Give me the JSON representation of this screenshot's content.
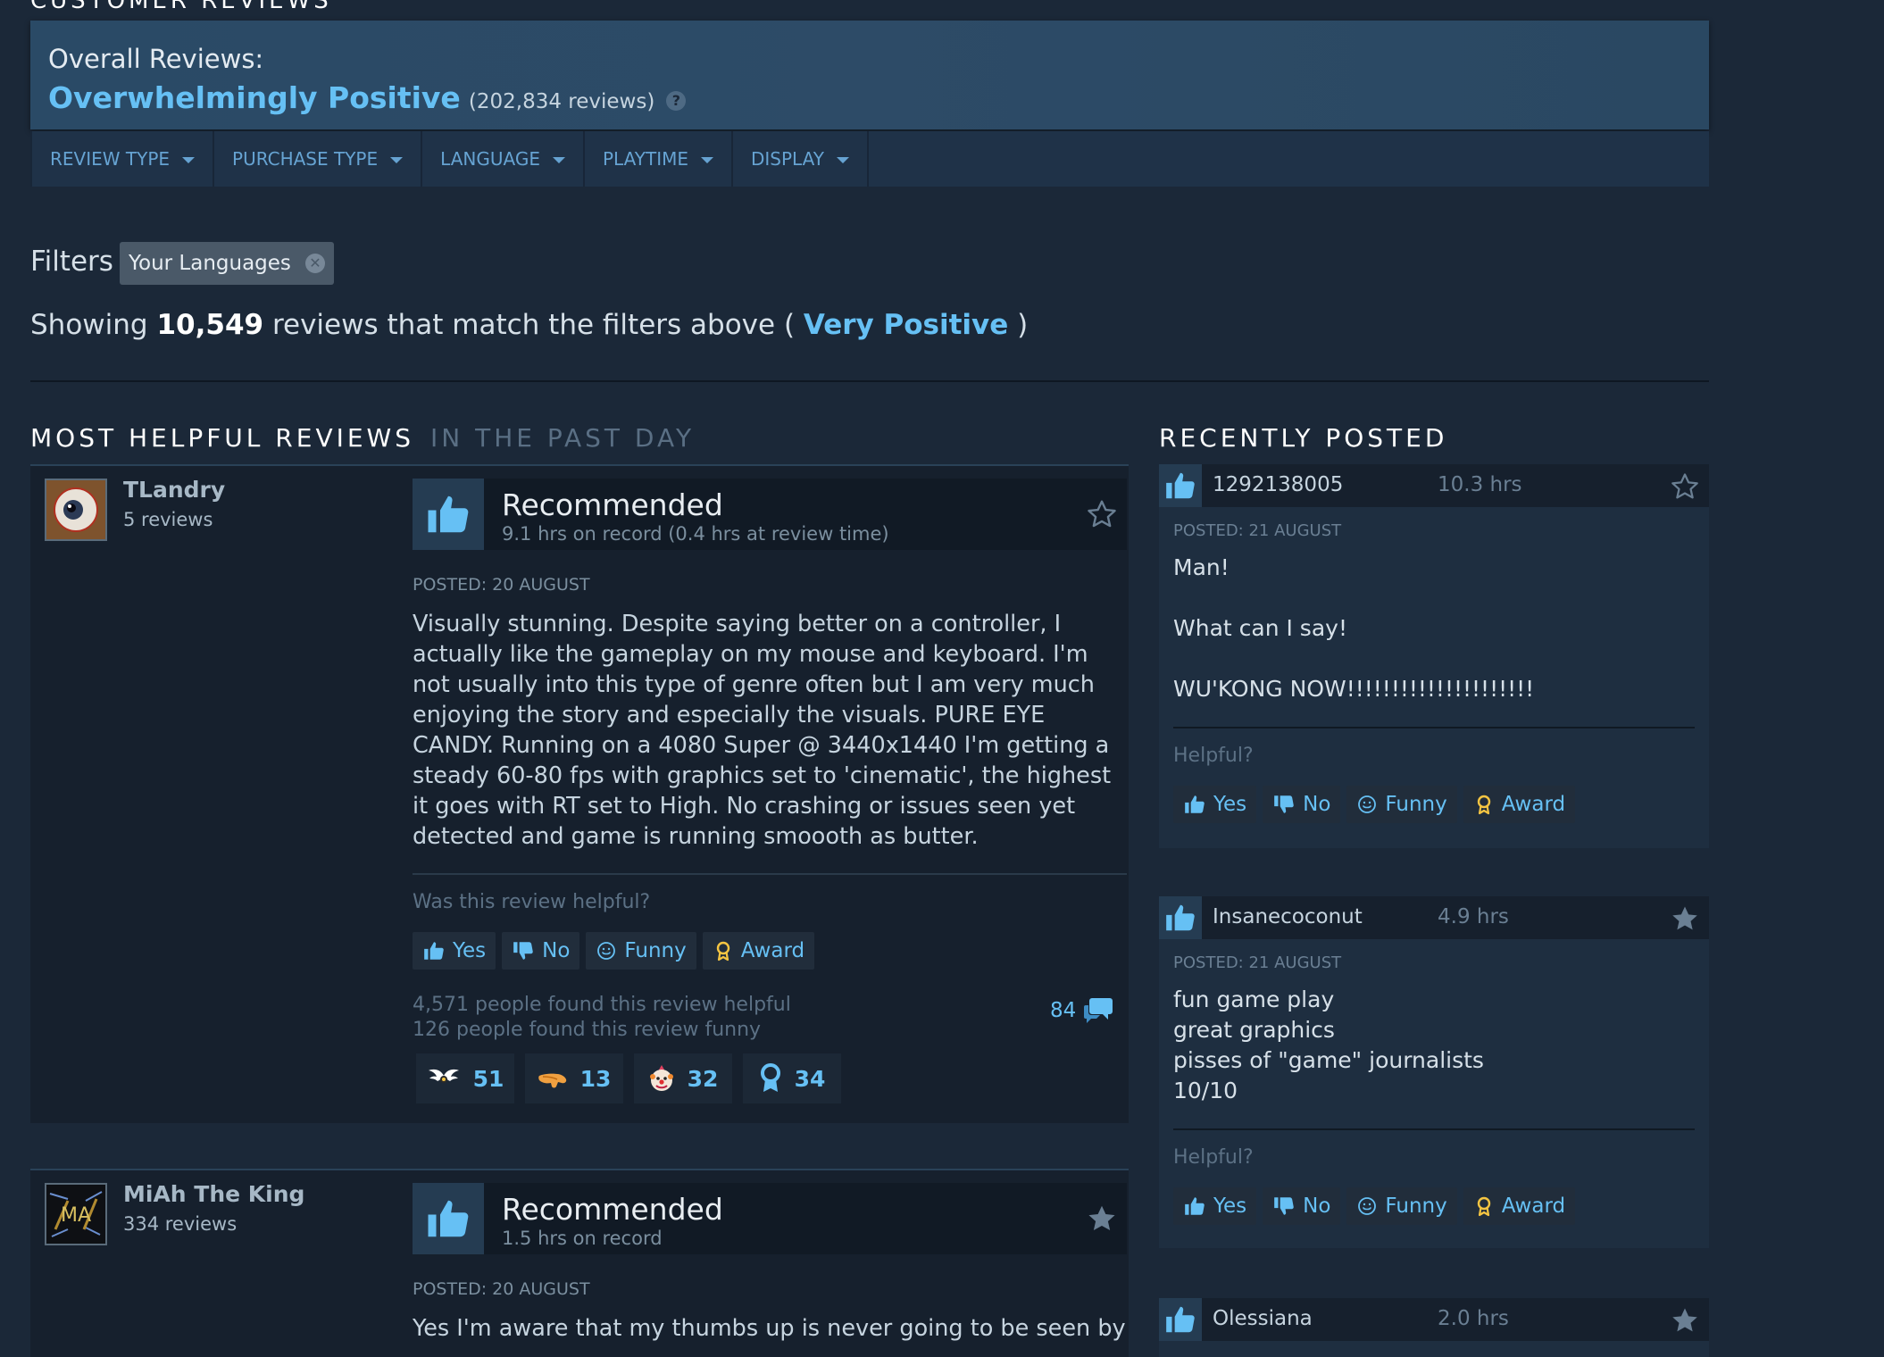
{
  "section": {
    "title": "Customer Reviews"
  },
  "overall": {
    "label": "Overall Reviews:",
    "score": "Overwhelmingly Positive",
    "count": "(202,834 reviews)",
    "help": "?"
  },
  "filter_tabs": [
    {
      "label": "Review Type"
    },
    {
      "label": "Purchase Type"
    },
    {
      "label": "Language"
    },
    {
      "label": "Playtime"
    },
    {
      "label": "Display"
    }
  ],
  "filters": {
    "label": "Filters",
    "chip": "Your Languages"
  },
  "showing": {
    "prefix": "Showing",
    "count": "10,549",
    "middle": "reviews that match the filters above (",
    "rating": "Very Positive",
    "suffix": ")"
  },
  "helpful_section": {
    "title": "Most Helpful Reviews",
    "period": "In the past day"
  },
  "recent_section": {
    "title": "Recently Posted"
  },
  "helpful_reviews": [
    {
      "author": "TLandry",
      "reviews": "5 reviews",
      "verdict": "Recommended",
      "hours": "9.1 hrs on record (0.4 hrs at review time)",
      "posted": "Posted: 20 August",
      "text": "Visually stunning. Despite saying better on a controller, I actually like the gameplay on my mouse and keyboard. I'm not usually into this type of genre often but I am very much enjoying the story and especially the visuals. PURE EYE CANDY. Running on a 4080 Super @ 3440x1440 I'm getting a steady 60-80 fps with graphics set to 'cinematic', the highest it goes with RT set to High. No crashing or issues seen yet detected and game is running smoooth as butter.",
      "helpful_q": "Was this review helpful?",
      "buttons": {
        "yes": "Yes",
        "no": "No",
        "funny": "Funny",
        "award": "Award"
      },
      "found_helpful": "4,571 people found this review helpful",
      "found_funny": "126 people found this review funny",
      "comments": "84",
      "awards": [
        "51",
        "13",
        "32",
        "34"
      ]
    },
    {
      "author": "MiAh The King",
      "avatar_text": "MA",
      "reviews": "334 reviews",
      "verdict": "Recommended",
      "hours": "1.5 hrs on record",
      "posted": "Posted: 20 August",
      "text": "Yes I'm aware that my thumbs up is never going to be seen by"
    }
  ],
  "recent_reviews": [
    {
      "name": "1292138005",
      "hours": "10.3 hrs",
      "posted": "Posted: 21 August",
      "text": "Man!\n\nWhat can I say!\n\nWU'KONG NOW!!!!!!!!!!!!!!!!!!!!!",
      "helpful_q": "Helpful?",
      "buttons": {
        "yes": "Yes",
        "no": "No",
        "funny": "Funny",
        "award": "Award"
      }
    },
    {
      "name": "Insanecoconut",
      "hours": "4.9 hrs",
      "posted": "Posted: 21 August",
      "text": "fun game play\ngreat graphics\npisses of \"game\" journalists\n10/10",
      "helpful_q": "Helpful?",
      "buttons": {
        "yes": "Yes",
        "no": "No",
        "funny": "Funny",
        "award": "Award"
      }
    },
    {
      "name": "Olessiana",
      "hours": "2.0 hrs"
    }
  ],
  "colors": {
    "background": "#1b2838",
    "accent": "#66c0f4",
    "panel": "#2a4a66"
  }
}
